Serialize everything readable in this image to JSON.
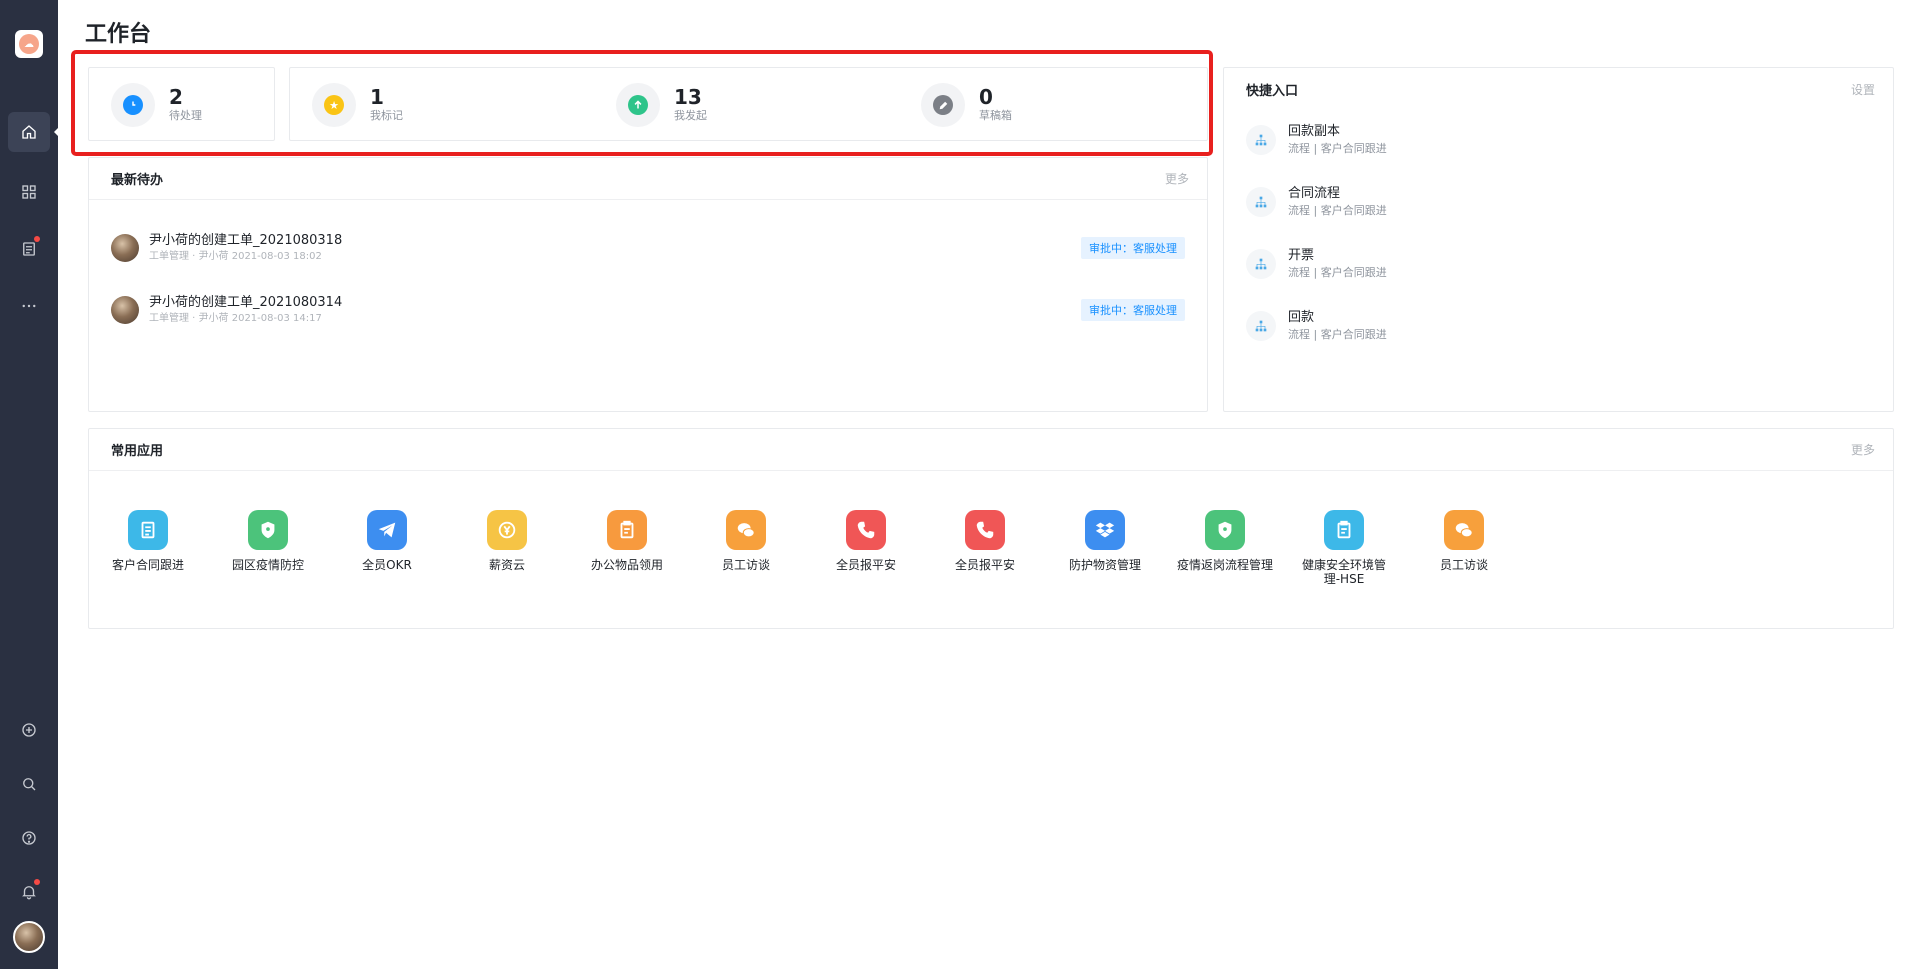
{
  "sidebar": {
    "items": [
      {
        "name": "home-icon",
        "active": true
      },
      {
        "name": "apps-grid-icon",
        "active": false
      },
      {
        "name": "document-icon",
        "active": false,
        "badge": true
      },
      {
        "name": "more-icon",
        "active": false
      },
      {
        "name": "add-circle-icon",
        "active": false
      },
      {
        "name": "search-icon",
        "active": false
      },
      {
        "name": "help-icon",
        "active": false
      },
      {
        "name": "bell-icon",
        "active": false,
        "badge": true
      }
    ]
  },
  "page": {
    "title": "工作台"
  },
  "stats": [
    {
      "value": "2",
      "label": "待处理",
      "color": "#1890ff",
      "icon": "clock-icon"
    },
    {
      "value": "1",
      "label": "我标记",
      "color": "#fac415",
      "icon": "star-icon"
    },
    {
      "value": "13",
      "label": "我发起",
      "color": "#2ec48a",
      "icon": "arrow-up-icon"
    },
    {
      "value": "0",
      "label": "草稿箱",
      "color": "#7b7f86",
      "icon": "pencil-icon"
    }
  ],
  "todos": {
    "title": "最新待办",
    "more": "更多",
    "items": [
      {
        "title": "尹小荷的创建工单_2021080318",
        "meta": "工单管理 · 尹小荷 2021-08-03 18:02",
        "status": "审批中：客服处理"
      },
      {
        "title": "尹小荷的创建工单_2021080314",
        "meta": "工单管理 · 尹小荷 2021-08-03 14:17",
        "status": "审批中：客服处理"
      }
    ]
  },
  "quick": {
    "title": "快捷入口",
    "settings": "设置",
    "items": [
      {
        "title": "回款副本",
        "meta": "流程 | 客户合同跟进"
      },
      {
        "title": "合同流程",
        "meta": "流程 | 客户合同跟进"
      },
      {
        "title": "开票",
        "meta": "流程 | 客户合同跟进"
      },
      {
        "title": "回款",
        "meta": "流程 | 客户合同跟进"
      }
    ]
  },
  "apps": {
    "title": "常用应用",
    "more": "更多",
    "items": [
      {
        "label": "客户合同跟进",
        "color": "#3db8e8",
        "icon": "document-icon"
      },
      {
        "label": "园区疫情防控",
        "color": "#4cc37b",
        "icon": "shield-icon"
      },
      {
        "label": "全员OKR",
        "color": "#3d8ef0",
        "icon": "paper-plane-icon"
      },
      {
        "label": "薪资云",
        "color": "#f6c445",
        "icon": "yen-icon"
      },
      {
        "label": "办公物品领用",
        "color": "#f79a3e",
        "icon": "clipboard-icon"
      },
      {
        "label": "员工访谈",
        "color": "#f7a03c",
        "icon": "chat-icon"
      },
      {
        "label": "全员报平安",
        "color": "#f05656",
        "icon": "phone-icon"
      },
      {
        "label": "全员报平安",
        "color": "#f05656",
        "icon": "phone-icon"
      },
      {
        "label": "防护物资管理",
        "color": "#3d8ef0",
        "icon": "dropbox-icon"
      },
      {
        "label": "疫情返岗流程管理",
        "color": "#4cc37b",
        "icon": "shield-icon"
      },
      {
        "label": "健康安全环境管理-HSE",
        "color": "#3db8e8",
        "icon": "clipboard-icon"
      },
      {
        "label": "员工访谈",
        "color": "#f7a03c",
        "icon": "chat-icon"
      }
    ]
  }
}
